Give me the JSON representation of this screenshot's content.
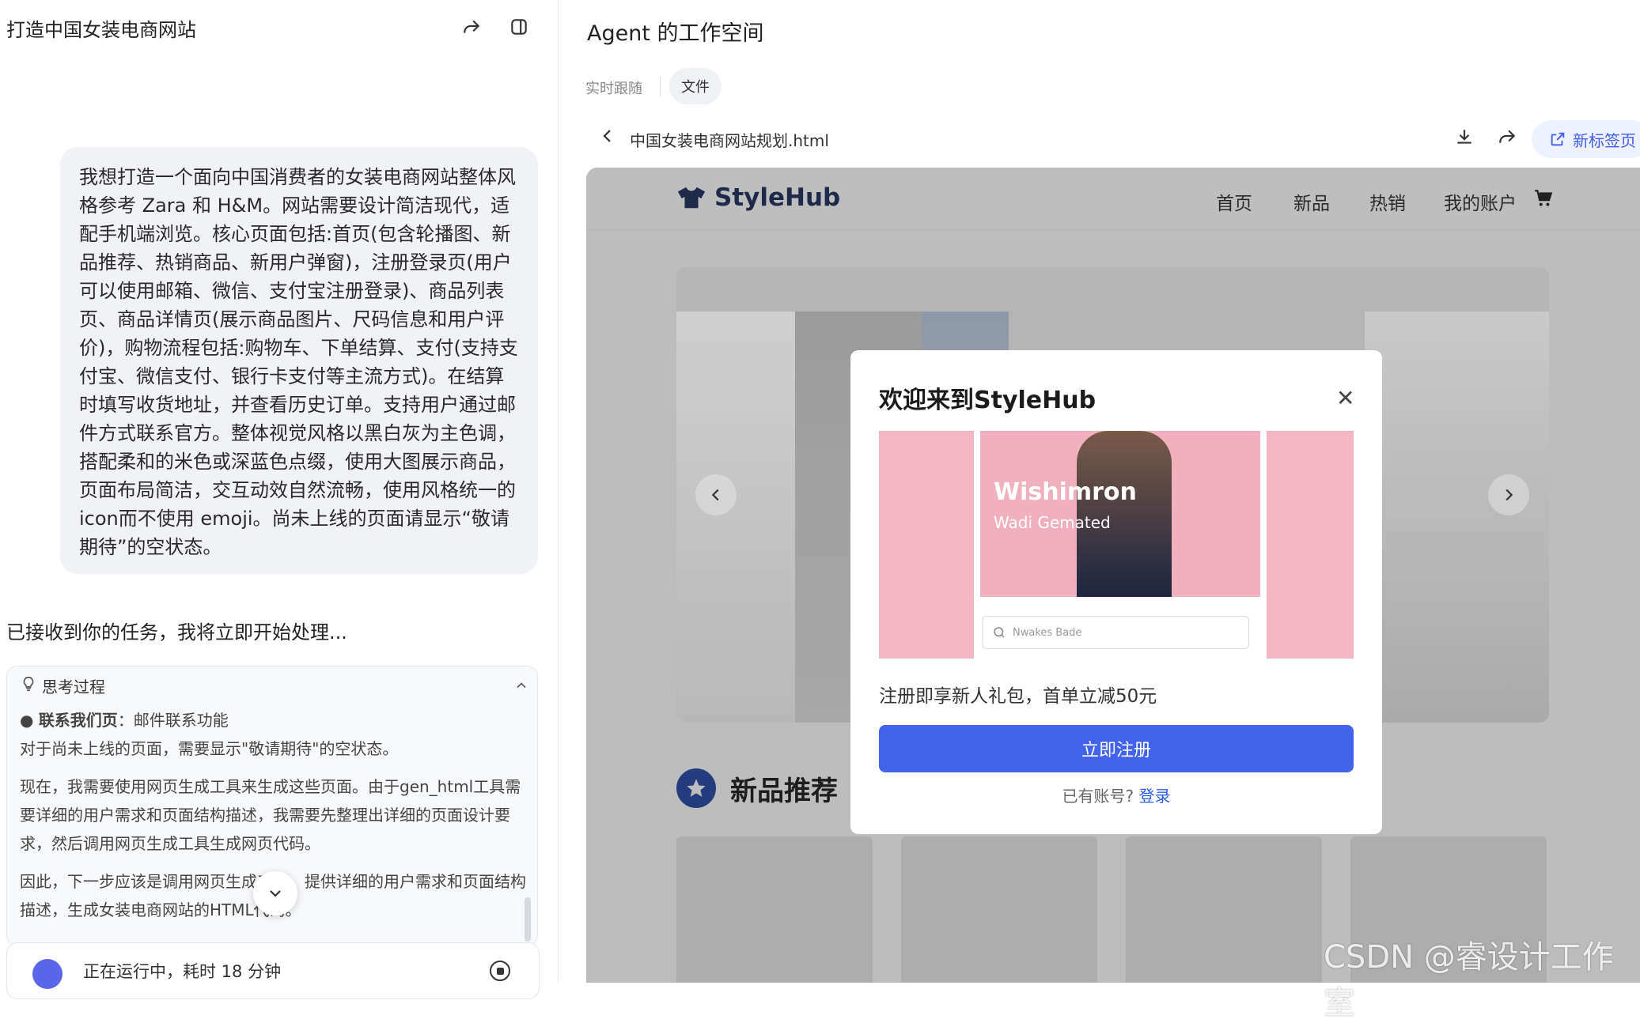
{
  "chat": {
    "title": "打造中国女装电商网站",
    "user_message": "我想打造一个面向中国消费者的女装电商网站整体风格参考 Zara 和 H&M。网站需要设计简洁现代，适配手机端浏览。核心页面包括:首页(包含轮播图、新品推荐、热销商品、新用户弹窗)，注册登录页(用户可以使用邮箱、微信、支付宝注册登录)、商品列表页、商品详情页(展示商品图片、尺码信息和用户评价)，购物流程包括:购物车、下单结算、支付(支持支付宝、微信支付、银行卡支付等主流方式)。在结算时填写收货地址，并查看历史订单。支持用户通过邮件方式联系官方。整体视觉风格以黑白灰为主色调，搭配柔和的米色或深蓝色点缀，使用大图展示商品，页面布局简洁，交互动效自然流畅，使用风格统一的icon而不使用 emoji。尚未上线的页面请显示“敬请期待”的空状态。",
    "assistant_reply": "已接收到你的任务，我将立即开始处理...",
    "thinking": {
      "label": "思考过程",
      "bullet_bold": "联系我们页",
      "bullet_rest": "：邮件联系功能",
      "paragraphs": [
        "对于尚未上线的页面，需要显示\"敬请期待\"的空状态。",
        "现在，我需要使用网页生成工具来生成这些页面。由于gen_html工具需要详细的用户需求和页面结构描述，我需要先整理出详细的页面设计要求，然后调用网页生成工具生成网页代码。",
        "因此，下一步应该是调用网页生成工具，提供详细的用户需求和页面结构描述，生成女装电商网站的HTML代码。"
      ]
    },
    "status": "正在运行中，耗时 18 分钟"
  },
  "workspace": {
    "title": "Agent 的工作空间",
    "tabs": [
      "实时跟随",
      "文件"
    ],
    "active_tab": "文件",
    "file_name": "中国女装电商网站规划.html",
    "new_tab_label": "新标签页"
  },
  "site": {
    "brand": "StyleHub",
    "nav": [
      "首页",
      "新品",
      "热销",
      "我的账户"
    ],
    "section_title": "新品推荐"
  },
  "modal": {
    "title": "欢迎来到StyleHub",
    "image_text_main": "Wishimron",
    "image_text_sub": "Wadi Gemated",
    "image_search_placeholder": "Nwakes Bade",
    "promo": "注册即享新人礼包，首单立减50元",
    "register_button": "立即注册",
    "have_account": "已有账号?",
    "login_link": "登录"
  },
  "watermark": "CSDN @睿设计工作室",
  "colors": {
    "accent": "#4263eb",
    "brand_navy": "#1e2a48",
    "pink": "#f3b6c2"
  }
}
